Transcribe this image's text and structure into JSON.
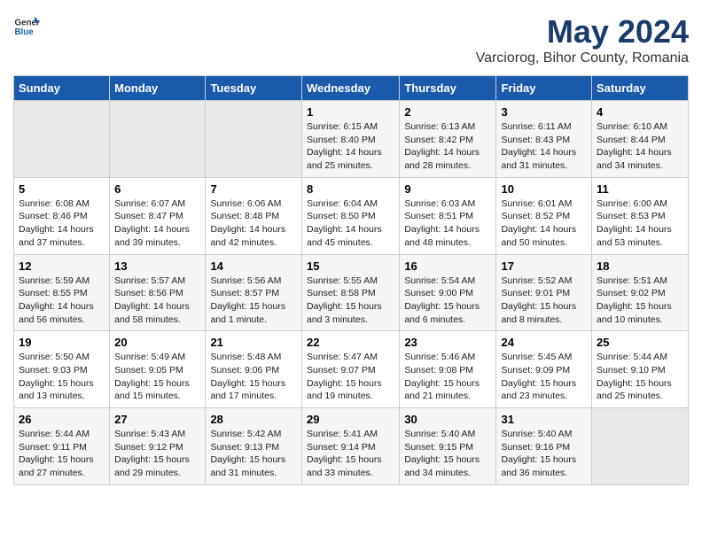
{
  "header": {
    "logo_general": "General",
    "logo_blue": "Blue",
    "title": "May 2024",
    "subtitle": "Varciorog, Bihor County, Romania"
  },
  "days_of_week": [
    "Sunday",
    "Monday",
    "Tuesday",
    "Wednesday",
    "Thursday",
    "Friday",
    "Saturday"
  ],
  "weeks": [
    [
      {
        "day": "",
        "info": ""
      },
      {
        "day": "",
        "info": ""
      },
      {
        "day": "",
        "info": ""
      },
      {
        "day": "1",
        "info": "Sunrise: 6:15 AM\nSunset: 8:40 PM\nDaylight: 14 hours\nand 25 minutes."
      },
      {
        "day": "2",
        "info": "Sunrise: 6:13 AM\nSunset: 8:42 PM\nDaylight: 14 hours\nand 28 minutes."
      },
      {
        "day": "3",
        "info": "Sunrise: 6:11 AM\nSunset: 8:43 PM\nDaylight: 14 hours\nand 31 minutes."
      },
      {
        "day": "4",
        "info": "Sunrise: 6:10 AM\nSunset: 8:44 PM\nDaylight: 14 hours\nand 34 minutes."
      }
    ],
    [
      {
        "day": "5",
        "info": "Sunrise: 6:08 AM\nSunset: 8:46 PM\nDaylight: 14 hours\nand 37 minutes."
      },
      {
        "day": "6",
        "info": "Sunrise: 6:07 AM\nSunset: 8:47 PM\nDaylight: 14 hours\nand 39 minutes."
      },
      {
        "day": "7",
        "info": "Sunrise: 6:06 AM\nSunset: 8:48 PM\nDaylight: 14 hours\nand 42 minutes."
      },
      {
        "day": "8",
        "info": "Sunrise: 6:04 AM\nSunset: 8:50 PM\nDaylight: 14 hours\nand 45 minutes."
      },
      {
        "day": "9",
        "info": "Sunrise: 6:03 AM\nSunset: 8:51 PM\nDaylight: 14 hours\nand 48 minutes."
      },
      {
        "day": "10",
        "info": "Sunrise: 6:01 AM\nSunset: 8:52 PM\nDaylight: 14 hours\nand 50 minutes."
      },
      {
        "day": "11",
        "info": "Sunrise: 6:00 AM\nSunset: 8:53 PM\nDaylight: 14 hours\nand 53 minutes."
      }
    ],
    [
      {
        "day": "12",
        "info": "Sunrise: 5:59 AM\nSunset: 8:55 PM\nDaylight: 14 hours\nand 56 minutes."
      },
      {
        "day": "13",
        "info": "Sunrise: 5:57 AM\nSunset: 8:56 PM\nDaylight: 14 hours\nand 58 minutes."
      },
      {
        "day": "14",
        "info": "Sunrise: 5:56 AM\nSunset: 8:57 PM\nDaylight: 15 hours\nand 1 minute."
      },
      {
        "day": "15",
        "info": "Sunrise: 5:55 AM\nSunset: 8:58 PM\nDaylight: 15 hours\nand 3 minutes."
      },
      {
        "day": "16",
        "info": "Sunrise: 5:54 AM\nSunset: 9:00 PM\nDaylight: 15 hours\nand 6 minutes."
      },
      {
        "day": "17",
        "info": "Sunrise: 5:52 AM\nSunset: 9:01 PM\nDaylight: 15 hours\nand 8 minutes."
      },
      {
        "day": "18",
        "info": "Sunrise: 5:51 AM\nSunset: 9:02 PM\nDaylight: 15 hours\nand 10 minutes."
      }
    ],
    [
      {
        "day": "19",
        "info": "Sunrise: 5:50 AM\nSunset: 9:03 PM\nDaylight: 15 hours\nand 13 minutes."
      },
      {
        "day": "20",
        "info": "Sunrise: 5:49 AM\nSunset: 9:05 PM\nDaylight: 15 hours\nand 15 minutes."
      },
      {
        "day": "21",
        "info": "Sunrise: 5:48 AM\nSunset: 9:06 PM\nDaylight: 15 hours\nand 17 minutes."
      },
      {
        "day": "22",
        "info": "Sunrise: 5:47 AM\nSunset: 9:07 PM\nDaylight: 15 hours\nand 19 minutes."
      },
      {
        "day": "23",
        "info": "Sunrise: 5:46 AM\nSunset: 9:08 PM\nDaylight: 15 hours\nand 21 minutes."
      },
      {
        "day": "24",
        "info": "Sunrise: 5:45 AM\nSunset: 9:09 PM\nDaylight: 15 hours\nand 23 minutes."
      },
      {
        "day": "25",
        "info": "Sunrise: 5:44 AM\nSunset: 9:10 PM\nDaylight: 15 hours\nand 25 minutes."
      }
    ],
    [
      {
        "day": "26",
        "info": "Sunrise: 5:44 AM\nSunset: 9:11 PM\nDaylight: 15 hours\nand 27 minutes."
      },
      {
        "day": "27",
        "info": "Sunrise: 5:43 AM\nSunset: 9:12 PM\nDaylight: 15 hours\nand 29 minutes."
      },
      {
        "day": "28",
        "info": "Sunrise: 5:42 AM\nSunset: 9:13 PM\nDaylight: 15 hours\nand 31 minutes."
      },
      {
        "day": "29",
        "info": "Sunrise: 5:41 AM\nSunset: 9:14 PM\nDaylight: 15 hours\nand 33 minutes."
      },
      {
        "day": "30",
        "info": "Sunrise: 5:40 AM\nSunset: 9:15 PM\nDaylight: 15 hours\nand 34 minutes."
      },
      {
        "day": "31",
        "info": "Sunrise: 5:40 AM\nSunset: 9:16 PM\nDaylight: 15 hours\nand 36 minutes."
      },
      {
        "day": "",
        "info": ""
      }
    ]
  ]
}
